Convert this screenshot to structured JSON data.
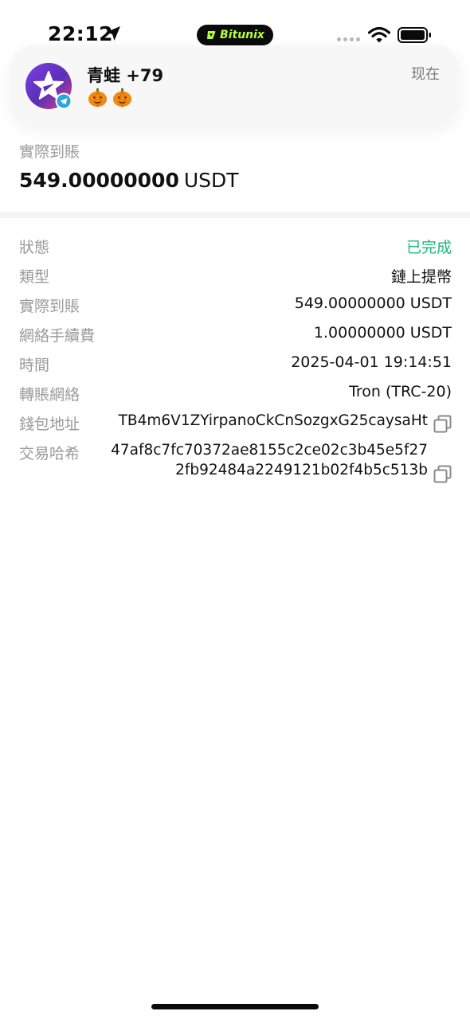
{
  "status_bar": {
    "time": "22:12",
    "island_app": "Bitunix",
    "icons": [
      "location-arrow-icon",
      "signal-dots-icon",
      "wifi-icon",
      "battery-icon"
    ],
    "accent_color": "#b6ff3b"
  },
  "notification": {
    "title": "青蛙 +79",
    "time": "现在",
    "emoji": "🎃🎃",
    "avatar_icon": "app-star-avatar-icon",
    "badge_icon": "telegram-icon"
  },
  "summary": {
    "label": "實際到賬",
    "amount": "549.00000000",
    "unit": "USDT"
  },
  "details": {
    "status": {
      "label": "狀態",
      "value": "已完成",
      "color": "#18b97a"
    },
    "type": {
      "label": "類型",
      "value": "鏈上提幣"
    },
    "received": {
      "label": "實際到賬",
      "value": "549.00000000 USDT"
    },
    "fee": {
      "label": "網絡手續費",
      "value": "1.00000000 USDT"
    },
    "time": {
      "label": "時間",
      "value": "2025-04-01 19:14:51"
    },
    "network": {
      "label": "轉賬網絡",
      "value": "Tron (TRC-20)"
    },
    "address": {
      "label": "錢包地址",
      "value": "TB4m6V1ZYirpanoCkCnSozgxG25caysaHt"
    },
    "hash": {
      "label": "交易哈希",
      "line1": "47af8c7fc70372ae8155c2ce02c3b45e5f27",
      "line2": "2fb92484a2249121b02f4b5c513b"
    }
  }
}
